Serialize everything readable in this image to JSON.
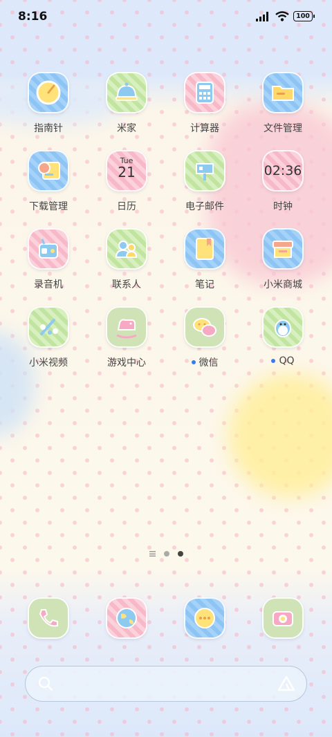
{
  "status_bar": {
    "time": "8:16",
    "battery": "100"
  },
  "apps": [
    {
      "label": "指南针",
      "icon": "compass-icon"
    },
    {
      "label": "米家",
      "icon": "smart-home-icon"
    },
    {
      "label": "计算器",
      "icon": "calculator-icon"
    },
    {
      "label": "文件管理",
      "icon": "folder-icon"
    },
    {
      "label": "下载管理",
      "icon": "download-manager-icon"
    },
    {
      "label": "日历",
      "icon": "calendar-icon",
      "weekday": "Tue",
      "day": "21"
    },
    {
      "label": "电子邮件",
      "icon": "mailbox-icon"
    },
    {
      "label": "时钟",
      "icon": "clock-icon",
      "time": "02:36"
    },
    {
      "label": "录音机",
      "icon": "recorder-icon"
    },
    {
      "label": "联系人",
      "icon": "contacts-icon"
    },
    {
      "label": "笔记",
      "icon": "notes-icon"
    },
    {
      "label": "小米商城",
      "icon": "store-icon"
    },
    {
      "label": "小米视频",
      "icon": "video-icon"
    },
    {
      "label": "游戏中心",
      "icon": "rocking-horse-icon"
    },
    {
      "label": "微信",
      "icon": "wechat-icon",
      "badge": "new"
    },
    {
      "label": "QQ",
      "icon": "qq-penguin-icon",
      "badge": "new"
    }
  ],
  "page_indicator": {
    "pages": 2,
    "active_page": 2
  },
  "dock": [
    {
      "icon": "phone-icon"
    },
    {
      "icon": "browser-globe-icon"
    },
    {
      "icon": "messages-icon"
    },
    {
      "icon": "camera-icon"
    }
  ],
  "search": {
    "icon": "search-icon",
    "assistant_icon": "assistant-icon"
  },
  "colors": {
    "badge": "#3a78f0",
    "tile_blue": "#8ec4f3",
    "tile_green": "#c1e4a0",
    "tile_pink": "#f7b8c8"
  }
}
